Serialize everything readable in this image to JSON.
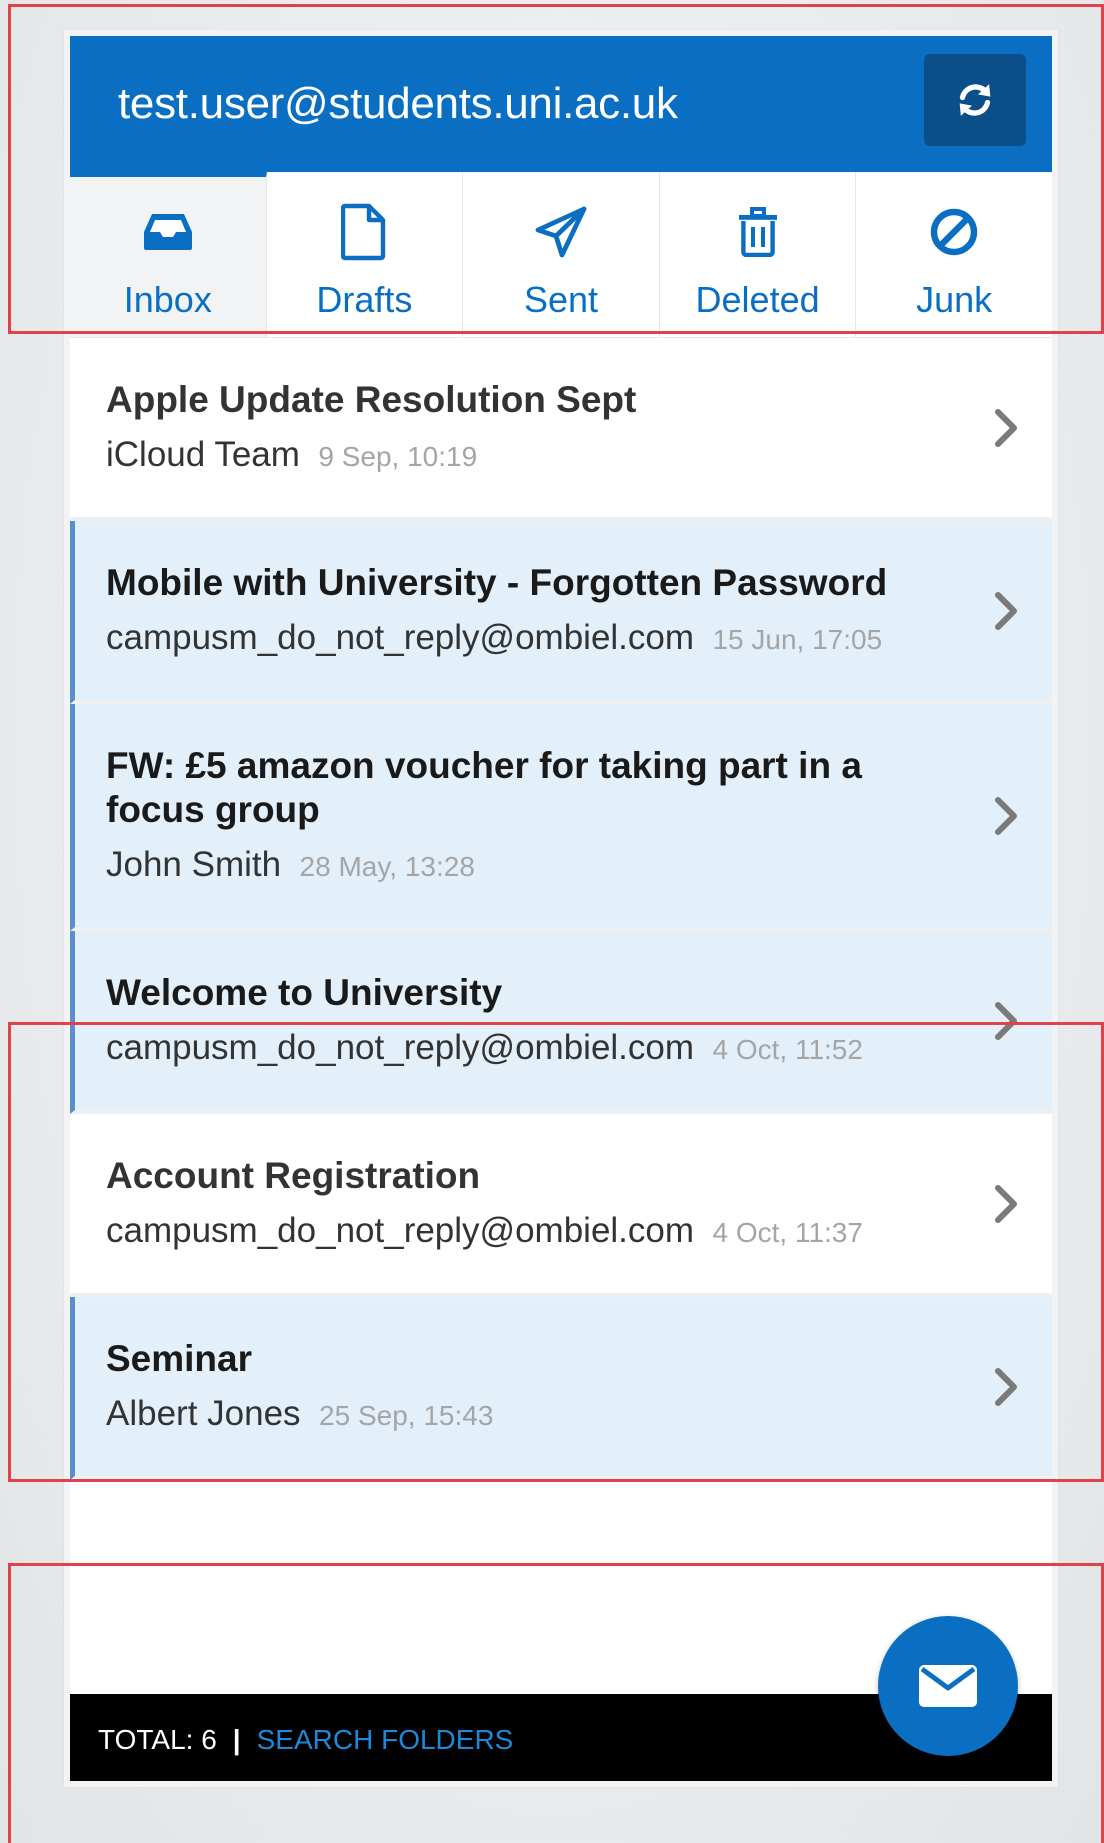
{
  "header": {
    "account": "test.user@students.uni.ac.uk",
    "refresh_icon": "refresh-icon"
  },
  "tabs": [
    {
      "label": "Inbox",
      "icon": "inbox-icon",
      "active": true
    },
    {
      "label": "Drafts",
      "icon": "draft-document-icon",
      "active": false
    },
    {
      "label": "Sent",
      "icon": "paper-plane-icon",
      "active": false
    },
    {
      "label": "Deleted",
      "icon": "trash-icon",
      "active": false
    },
    {
      "label": "Junk",
      "icon": "ban-icon",
      "active": false
    }
  ],
  "messages": [
    {
      "subject": "Apple Update Resolution Sept",
      "sender": "iCloud Team",
      "date": "9 Sep, 10:19",
      "unread": false
    },
    {
      "subject": "Mobile with University - Forgotten Password",
      "sender": "campusm_do_not_reply@ombiel.com",
      "date": "15 Jun, 17:05",
      "unread": true
    },
    {
      "subject": "FW: £5 amazon voucher for taking part in a focus group",
      "sender": "John Smith",
      "date": "28 May, 13:28",
      "unread": true
    },
    {
      "subject": "Welcome to University",
      "sender": "campusm_do_not_reply@ombiel.com",
      "date": "4 Oct, 11:52",
      "unread": true
    },
    {
      "subject": "Account Registration",
      "sender": "campusm_do_not_reply@ombiel.com",
      "date": "4 Oct, 11:37",
      "unread": false
    },
    {
      "subject": "Seminar",
      "sender": "Albert Jones",
      "date": "25 Sep, 15:43",
      "unread": true
    }
  ],
  "footer": {
    "total_label": "TOTAL: 6",
    "separator": "|",
    "search_label": "SEARCH FOLDERS"
  },
  "compose": {
    "icon": "envelope-icon"
  },
  "colors": {
    "brand_blue": "#0a6fc2",
    "dark_blue": "#0a4f8a",
    "unread_bg": "#e3f0fa",
    "unread_accent": "#5b8fc9",
    "highlight_red": "#e0414a"
  }
}
